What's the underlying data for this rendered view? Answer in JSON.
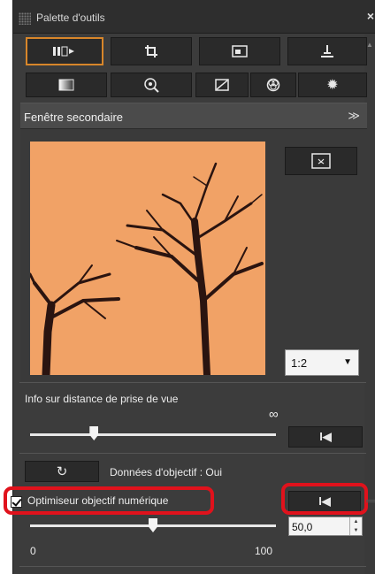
{
  "window": {
    "title": "Palette d'outils",
    "close_glyph": "×"
  },
  "tabs_row1": [
    {
      "icon": "basic-adjust-icon",
      "glyph": "▮▯▸",
      "active": true
    },
    {
      "icon": "crop-icon",
      "glyph": "⌗"
    },
    {
      "icon": "image-icon",
      "glyph": "▣"
    },
    {
      "icon": "stamp-icon",
      "glyph": "⊥"
    }
  ],
  "tabs_row2": [
    {
      "icon": "gradient-icon",
      "glyph": "◧"
    },
    {
      "icon": "lens-search-icon",
      "glyph": "⊕"
    },
    {
      "icon": "tone-curve-icon",
      "glyph": "◿"
    },
    {
      "icon": "color-wheel-icon",
      "glyph": "⊛"
    },
    {
      "icon": "settings-gear-icon",
      "glyph": "✹"
    }
  ],
  "section": {
    "title": "Fenêtre secondaire",
    "collapse_glyph": "≫"
  },
  "preview": {
    "zoom_value": "1:2",
    "zoom_arrow": "▼",
    "fit_glyph": "⊡"
  },
  "distance": {
    "label": "Info sur distance de prise de vue",
    "infinity": "∞",
    "slider_level": 0.26,
    "reset_glyph": "I◀"
  },
  "lens_data": {
    "refresh_glyph": "↻",
    "label": "Données d'objectif : Oui"
  },
  "optimizer": {
    "checkbox_label": "Optimiseur objectif numérique",
    "checked": true,
    "reset_glyph": "I◀",
    "slider_value": "50,0",
    "slider_level": 0.5,
    "min_label": "0",
    "max_label": "100"
  },
  "colors": {
    "panel_bg": "#3c3c3c",
    "active_tab_border": "#d8862a",
    "highlight_red": "#e0121c",
    "preview_sky": "#f0a065"
  }
}
